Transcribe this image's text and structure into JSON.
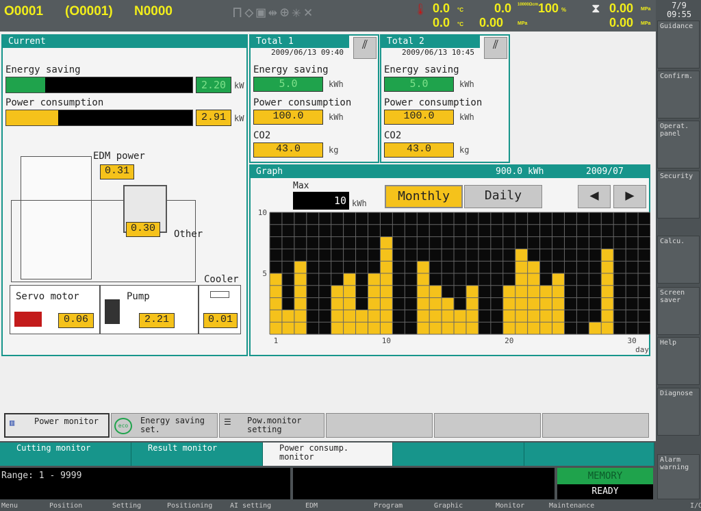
{
  "topbar": {
    "program": "O0001",
    "program_paren": "(O0001)",
    "seq": "N0000",
    "temp1": "0.0",
    "temp1_unit": "°C",
    "temp2": "0.0",
    "temp2_unit": "°C",
    "resist": "0.0",
    "resist_unit": "10000Ωcm",
    "press1": "0.00",
    "press1_unit": "MPa",
    "override": "100",
    "override_unit": "%",
    "press2": "0.00",
    "press2_unit": "MPa",
    "press3": "0.00",
    "press3_unit": "MPa",
    "date": "7/9",
    "time": "09:55"
  },
  "current": {
    "title": "Current",
    "energy_saving_label": "Energy saving",
    "energy_saving_value": "2.20",
    "energy_saving_unit": "kW",
    "energy_saving_fill": 0.21,
    "power_label": "Power consumption",
    "power_value": "2.91",
    "power_unit": "kW",
    "power_fill": 0.28,
    "edm_label": "EDM power",
    "edm_value": "0.31",
    "other_label": "Other",
    "other_value": "0.30",
    "cooler_label": "Cooler",
    "cooler_value": "0.01",
    "servo_label": "Servo motor",
    "servo_value": "0.06",
    "pump_label": "Pump",
    "pump_value": "2.21"
  },
  "totals": [
    {
      "title": "Total 1",
      "date": "2009/06/13 09:40",
      "energy_saving_label": "Energy saving",
      "energy_saving_value": "5.0",
      "energy_unit": "kWh",
      "power_label": "Power consumption",
      "power_value": "100.0",
      "power_unit": "kWh",
      "co2_label": "CO2",
      "co2_value": "43.0",
      "co2_unit": "kg"
    },
    {
      "title": "Total 2",
      "date": "2009/06/13 10:45",
      "energy_saving_label": "Energy saving",
      "energy_saving_value": "5.0",
      "energy_unit": "kWh",
      "power_label": "Power consumption",
      "power_value": "100.0",
      "power_unit": "kWh",
      "co2_label": "CO2",
      "co2_value": "43.0",
      "co2_unit": "kg"
    }
  ],
  "graph": {
    "title": "Graph",
    "total": "900.0 kWh",
    "period": "2009/07",
    "max_label": "Max",
    "max_value": "10",
    "max_unit": "kWh",
    "monthly": "Monthly",
    "daily": "Daily"
  },
  "chart_data": {
    "type": "bar",
    "xlabel": "day",
    "ylim": [
      0,
      10
    ],
    "yticks": [
      "5",
      "10"
    ],
    "xticks": [
      "1",
      "10",
      "20",
      "30"
    ],
    "x": [
      1,
      2,
      3,
      4,
      5,
      6,
      7,
      8,
      9,
      10,
      11,
      12,
      13,
      14,
      15,
      16,
      17,
      18,
      19,
      20,
      21,
      22,
      23,
      24,
      25,
      26,
      27,
      28,
      29,
      30,
      31
    ],
    "values": [
      5,
      2,
      6,
      0,
      0,
      4,
      5,
      2,
      5,
      8,
      0,
      0,
      6,
      4,
      3,
      2,
      4,
      0,
      0,
      4,
      7,
      6,
      4,
      5,
      0,
      0,
      1,
      7,
      0,
      0,
      0
    ],
    "bar_color": "#f5c21b",
    "bg_color": "#0a0a0a"
  },
  "softkeys": [
    "Power monitor",
    "Energy saving set.",
    "Pow.monitor setting",
    "",
    "",
    ""
  ],
  "tabs": [
    "Cutting monitor",
    "Result monitor",
    "Power consump. monitor",
    "",
    ""
  ],
  "status": {
    "range": "Range: 1 - 9999",
    "mode": "MEMORY",
    "state": "READY"
  },
  "menu": [
    "Menu",
    "Position",
    "Setting",
    "Positioning",
    "AI setting",
    "EDM",
    "Program",
    "Graphic",
    "Monitor",
    "Maintenance",
    "I/O"
  ],
  "sidebar": [
    "Guidance",
    "Confirm.",
    "Operat. panel",
    "Security",
    "Calcu.",
    "Screen saver",
    "Help",
    "Diagnose",
    "Alarm warning"
  ]
}
